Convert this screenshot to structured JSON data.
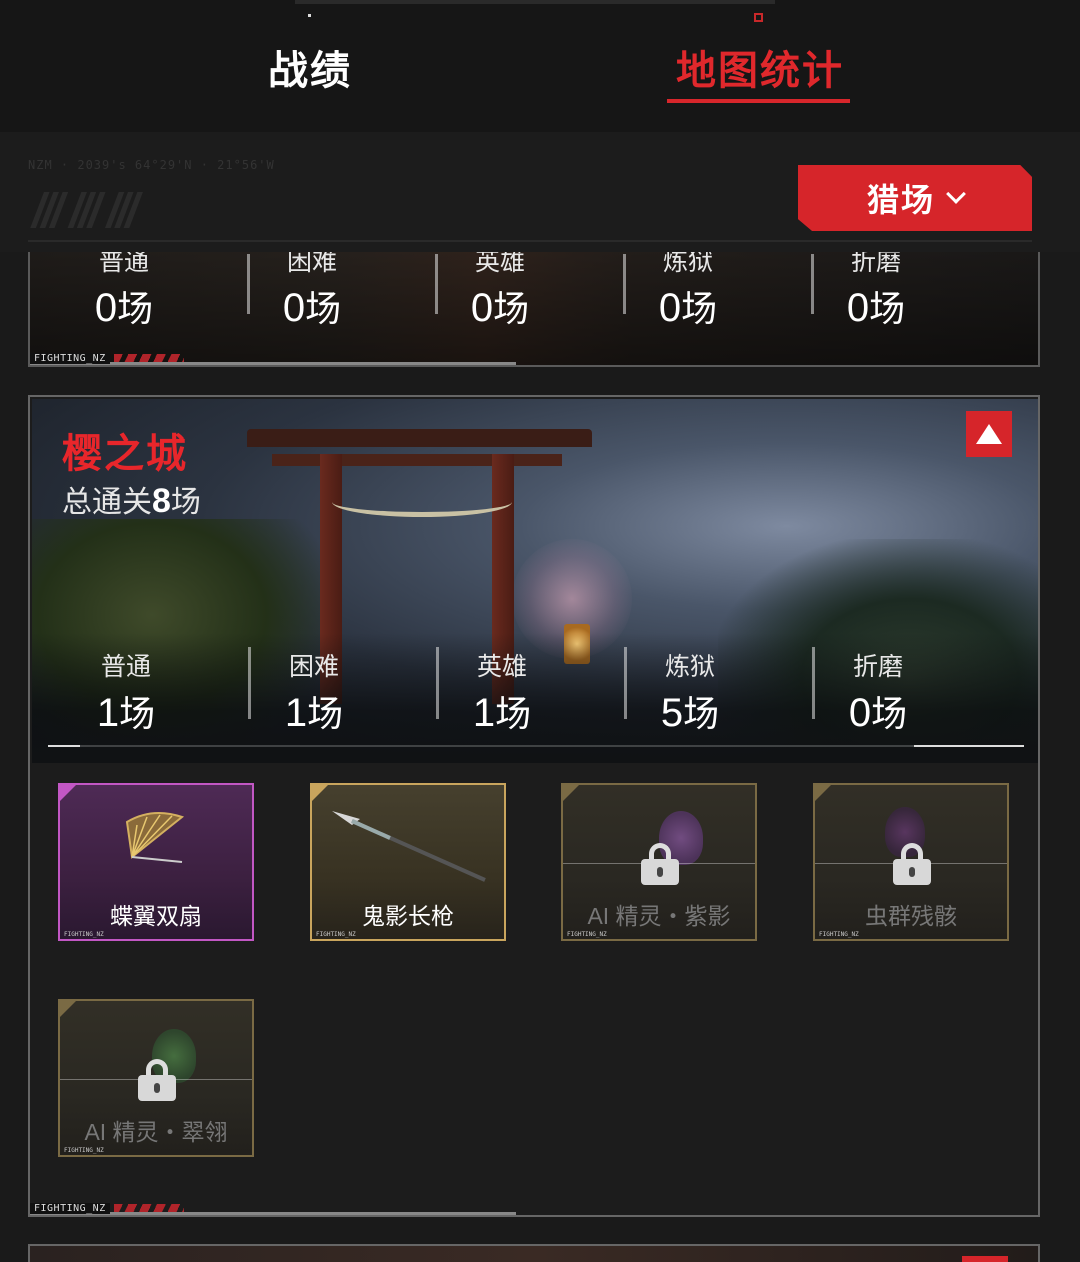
{
  "tabs": [
    {
      "label": "战绩",
      "active": false
    },
    {
      "label": "地图统计",
      "active": true
    }
  ],
  "subheader": {
    "coords": "NZM · 2039's 64°29'N · 21°56'W",
    "mode_select": {
      "value": "猎场"
    }
  },
  "difficulty_labels": [
    "普通",
    "困难",
    "英雄",
    "炼狱",
    "折磨"
  ],
  "card_footer_tag": "FIGHTING_NZ",
  "map_prev": {
    "stats": [
      {
        "label": "普通",
        "count": "0",
        "unit": "场"
      },
      {
        "label": "困难",
        "count": "0",
        "unit": "场"
      },
      {
        "label": "英雄",
        "count": "0",
        "unit": "场"
      },
      {
        "label": "炼狱",
        "count": "0",
        "unit": "场"
      },
      {
        "label": "折磨",
        "count": "0",
        "unit": "场"
      }
    ]
  },
  "map_current": {
    "title": "樱之城",
    "total_prefix": "总通关",
    "total_count": "8",
    "total_unit": "场",
    "stats": [
      {
        "label": "普通",
        "count": "1",
        "unit": "场"
      },
      {
        "label": "困难",
        "count": "1",
        "unit": "场"
      },
      {
        "label": "英雄",
        "count": "1",
        "unit": "场"
      },
      {
        "label": "炼狱",
        "count": "5",
        "unit": "场"
      },
      {
        "label": "折磨",
        "count": "0",
        "unit": "场"
      }
    ],
    "rewards": [
      {
        "name": "蝶翼双扇",
        "rarity": "purple",
        "locked": false,
        "icon": "fan-icon"
      },
      {
        "name": "鬼影长枪",
        "rarity": "gold",
        "locked": false,
        "icon": "spear-icon"
      },
      {
        "name": "AI 精灵・紫影",
        "rarity": "gold",
        "locked": true,
        "icon": "lock-icon"
      },
      {
        "name": "虫群残骸",
        "rarity": "gold",
        "locked": true,
        "icon": "lock-icon"
      },
      {
        "name": "AI 精灵・翠翎",
        "rarity": "gold",
        "locked": true,
        "icon": "lock-icon"
      }
    ]
  },
  "colors": {
    "accent_red": "#d6252a",
    "purple_rarity": "#c257c4",
    "gold_rarity": "#c9a55d"
  }
}
